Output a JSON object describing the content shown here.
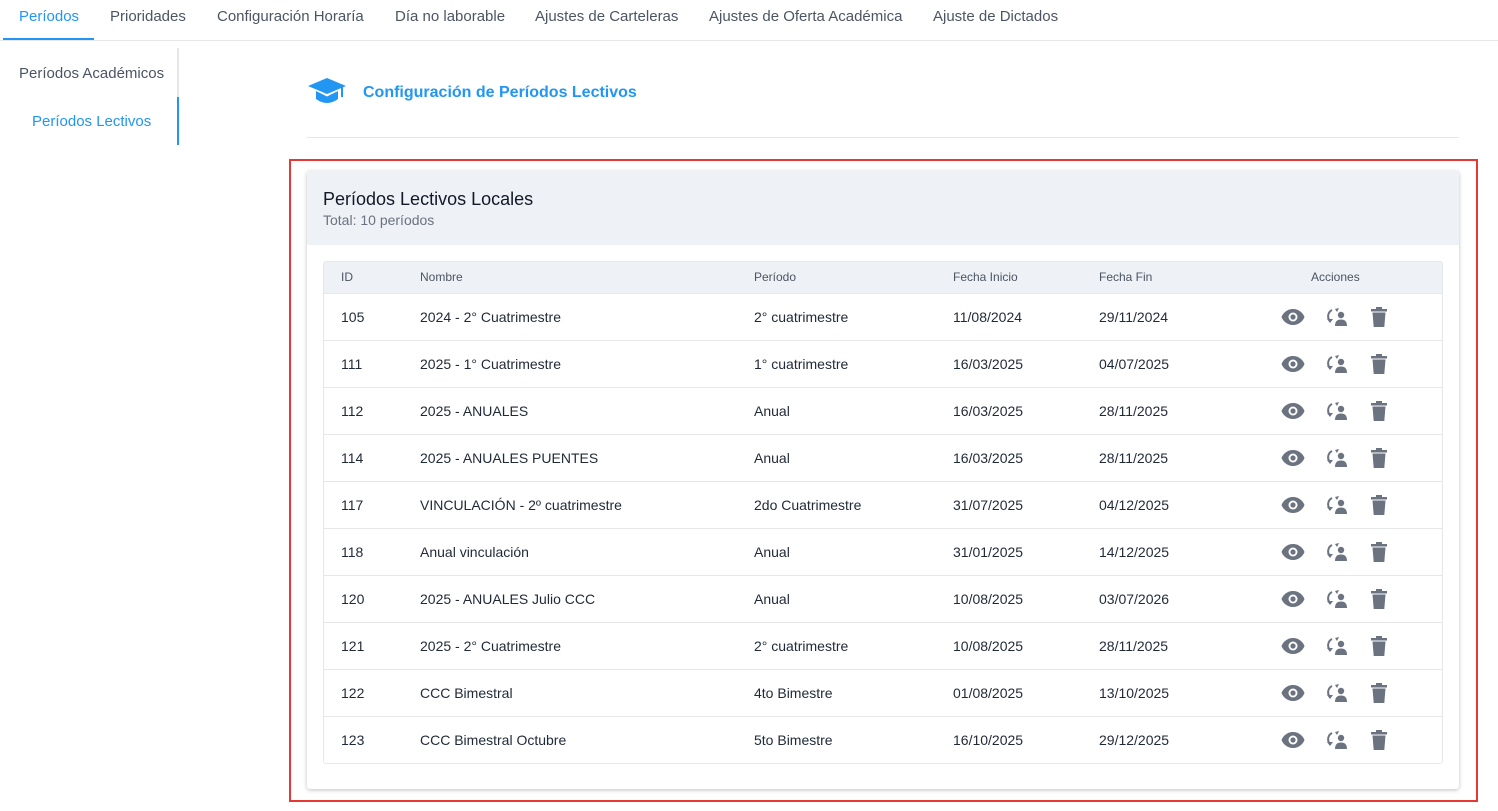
{
  "tabs": [
    {
      "label": "Períodos",
      "active": true
    },
    {
      "label": "Prioridades",
      "active": false
    },
    {
      "label": "Configuración Horaría",
      "active": false
    },
    {
      "label": "Día no laborable",
      "active": false
    },
    {
      "label": "Ajustes de Carteleras",
      "active": false
    },
    {
      "label": "Ajustes de Oferta Académica",
      "active": false
    },
    {
      "label": "Ajuste de Dictados",
      "active": false
    }
  ],
  "side_menu": [
    {
      "label": "Períodos Académicos",
      "active": false
    },
    {
      "label": "Períodos Lectivos",
      "active": true
    }
  ],
  "header": {
    "icon": "graduation-cap-icon",
    "title": "Configuración de Períodos Lectivos"
  },
  "card": {
    "title": "Períodos Lectivos Locales",
    "subtitle": "Total: 10 períodos"
  },
  "table": {
    "columns": [
      "ID",
      "Nombre",
      "Período",
      "Fecha Inicio",
      "Fecha Fin",
      "Acciones"
    ],
    "rows": [
      {
        "id": "105",
        "nombre": "2024 - 2° Cuatrimestre",
        "periodo": "2° cuatrimestre",
        "inicio": "11/08/2024",
        "fin": "29/11/2024"
      },
      {
        "id": "111",
        "nombre": "2025 - 1° Cuatrimestre",
        "periodo": "1° cuatrimestre",
        "inicio": "16/03/2025",
        "fin": "04/07/2025"
      },
      {
        "id": "112",
        "nombre": "2025 - ANUALES",
        "periodo": "Anual",
        "inicio": "16/03/2025",
        "fin": "28/11/2025"
      },
      {
        "id": "114",
        "nombre": "2025 - ANUALES PUENTES",
        "periodo": "Anual",
        "inicio": "16/03/2025",
        "fin": "28/11/2025"
      },
      {
        "id": "117",
        "nombre": "VINCULACIÓN - 2º cuatrimestre",
        "periodo": "2do Cuatrimestre",
        "inicio": "31/07/2025",
        "fin": "04/12/2025"
      },
      {
        "id": "118",
        "nombre": "Anual vinculación",
        "periodo": "Anual",
        "inicio": "31/01/2025",
        "fin": "14/12/2025"
      },
      {
        "id": "120",
        "nombre": "2025 - ANUALES Julio CCC",
        "periodo": "Anual",
        "inicio": "10/08/2025",
        "fin": "03/07/2026"
      },
      {
        "id": "121",
        "nombre": "2025 - 2° Cuatrimestre",
        "periodo": "2° cuatrimestre",
        "inicio": "10/08/2025",
        "fin": "28/11/2025"
      },
      {
        "id": "122",
        "nombre": "CCC Bimestral",
        "periodo": "4to Bimestre",
        "inicio": "01/08/2025",
        "fin": "13/10/2025"
      },
      {
        "id": "123",
        "nombre": "CCC Bimestral Octubre",
        "periodo": "5to Bimestre",
        "inicio": "16/10/2025",
        "fin": "29/12/2025"
      }
    ],
    "row_actions": [
      "eye-icon",
      "user-sync-icon",
      "trash-icon"
    ]
  },
  "colors": {
    "accent": "#2196f3",
    "highlight_border": "#e53935",
    "header_bg": "#eef1f5",
    "icon_gray": "#6b7280"
  }
}
